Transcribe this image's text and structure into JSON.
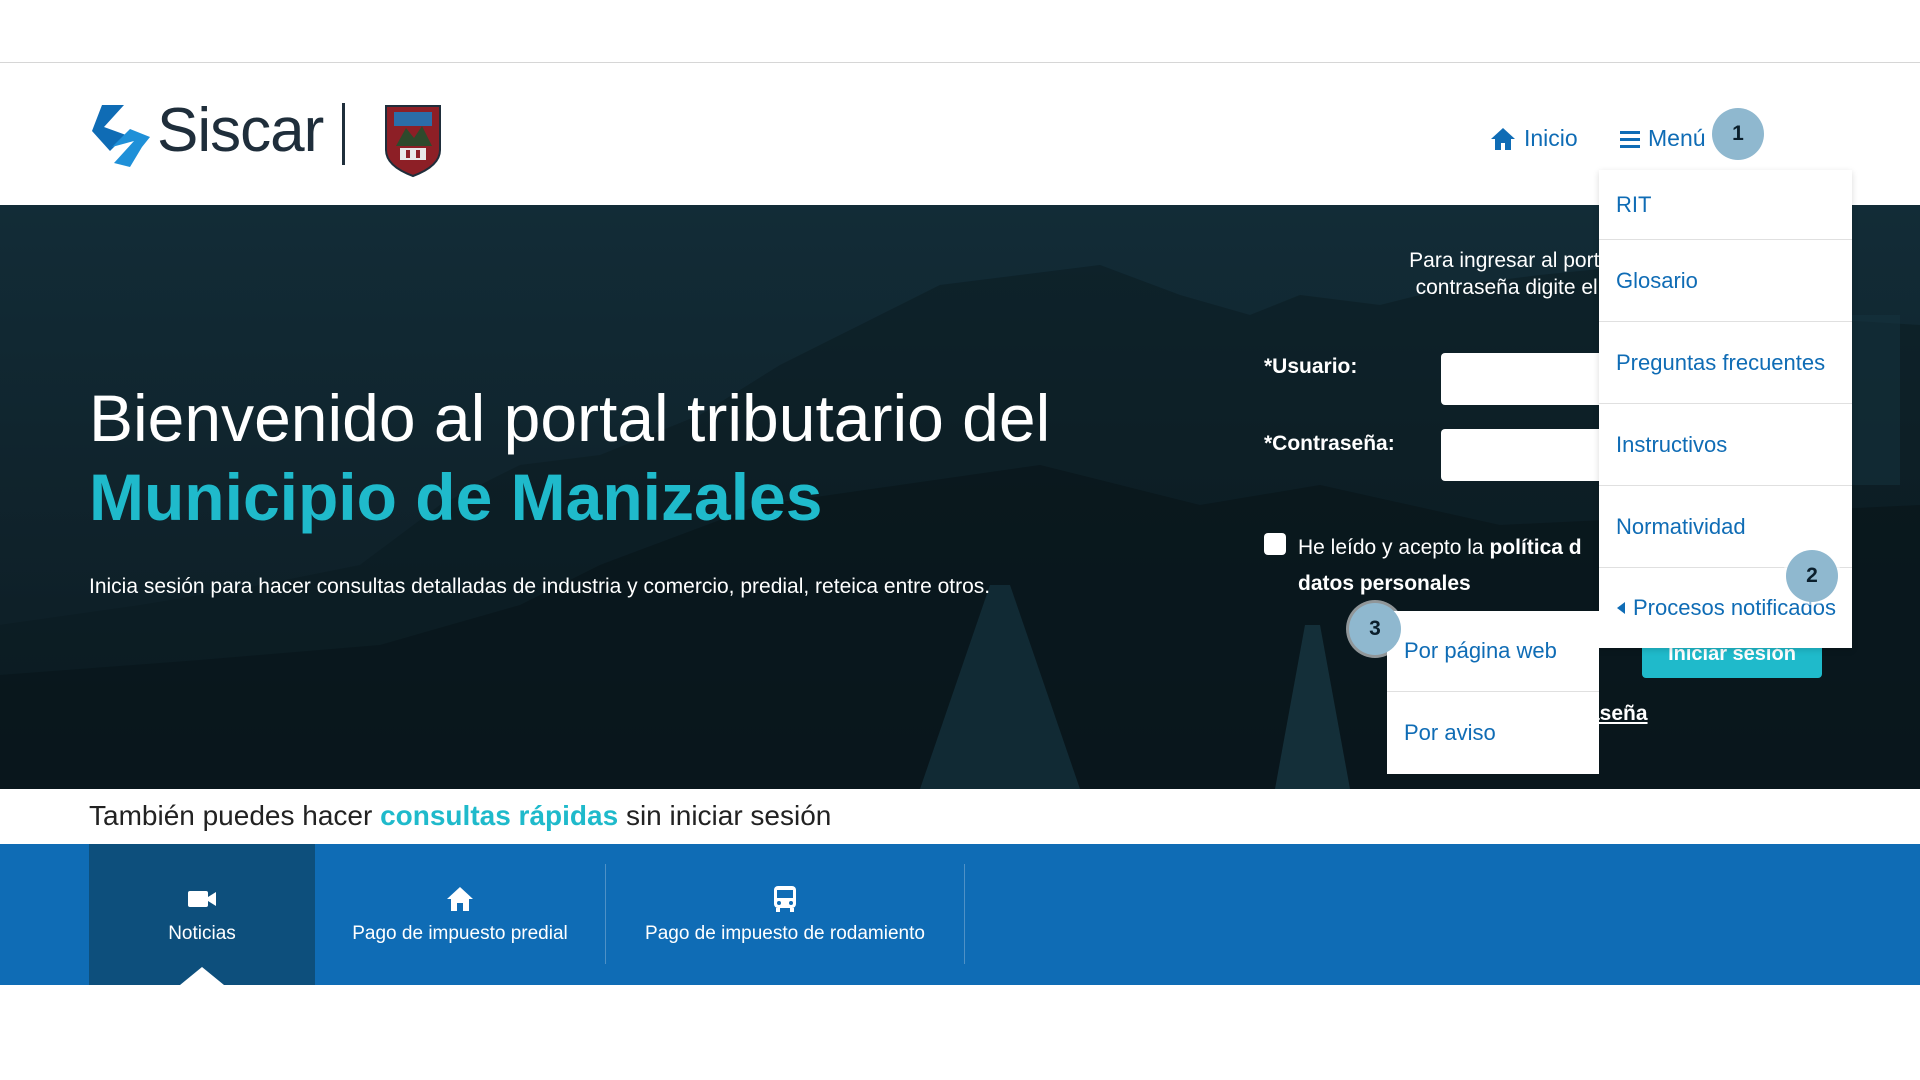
{
  "header": {
    "brand": "Siscar",
    "nav": {
      "inicio": "Inicio",
      "menu": "Menú"
    }
  },
  "annotations": {
    "b1": "1",
    "b2": "2",
    "b3": "3"
  },
  "hero": {
    "title_line1": "Bienvenido al portal tributario del",
    "title_line2": "Municipio de Manizales",
    "subtitle": "Inicia sesión para hacer consultas detalladas de industria y comercio, predial, reteica entre otros."
  },
  "login": {
    "instructions_line1": "Para ingresar al portal, en",
    "instructions_line2": "contraseña digite el núm",
    "user_label": "*Usuario:",
    "password_label": "*Contraseña:",
    "consent_prefix": "He leído y acepto la ",
    "consent_bold1": "política d",
    "consent_bold2": "datos personales",
    "login_button": "Iniciar sesión",
    "forgot_fragment": "aseña"
  },
  "menu": {
    "items": [
      "RIT",
      "Glosario",
      "Preguntas frecuentes",
      "Instructivos",
      "Normatividad"
    ],
    "expanded_item": "Procesos notificados",
    "submenu": [
      "Por página web",
      "Por aviso"
    ]
  },
  "quick": {
    "prefix": "También puedes hacer ",
    "highlight": "consultas rápidas",
    "suffix": " sin iniciar sesión"
  },
  "tabs": [
    {
      "label": "Noticias",
      "icon": "video-camera-icon",
      "active": true
    },
    {
      "label": "Pago de impuesto predial",
      "icon": "house-icon",
      "active": false
    },
    {
      "label": "Pago de impuesto de rodamiento",
      "icon": "bus-icon",
      "active": false
    }
  ],
  "colors": {
    "primary_blue": "#0f6cb5",
    "teal": "#1fbacb",
    "active_tab": "#0d4f7c",
    "badge": "#8fb8cf"
  }
}
